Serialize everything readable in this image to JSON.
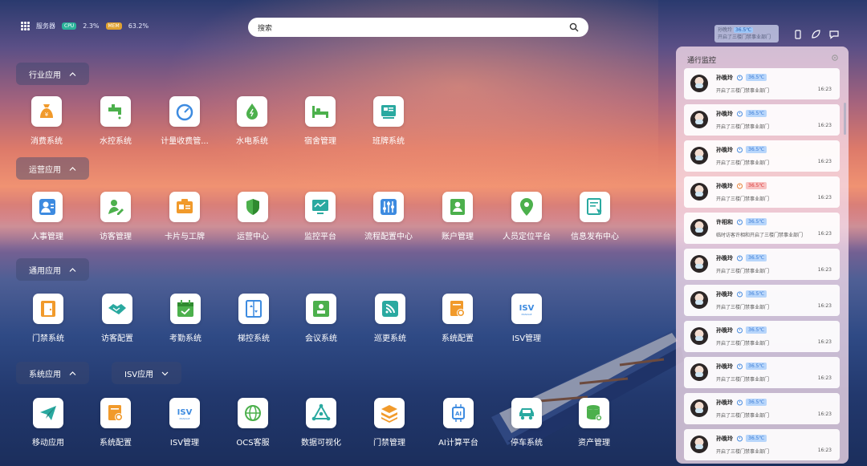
{
  "topbar": {
    "server_label": "服务器",
    "cpu_badge": "CPU",
    "cpu_value": "2.3%",
    "mem_badge": "MEM",
    "mem_value": "63.2%",
    "search_placeholder": "搜索",
    "user_chip": {
      "name": "孙晚玲",
      "temp": "36.5℃",
      "msg": "开启了三楼门禁事业部门"
    }
  },
  "sections": {
    "industry": {
      "label": "行业应用"
    },
    "operation": {
      "label": "运营应用"
    },
    "general": {
      "label": "通用应用"
    },
    "system": {
      "label": "系统应用"
    },
    "isv": {
      "label": "ISV应用"
    }
  },
  "apps": {
    "industry": [
      "消费系统",
      "水控系统",
      "计量收费管...",
      "水电系统",
      "宿舍管理",
      "班牌系统"
    ],
    "operation": [
      "人事管理",
      "访客管理",
      "卡片与工牌",
      "运营中心",
      "监控平台",
      "流程配置中心",
      "账户管理",
      "人员定位平台",
      "信息发布中心"
    ],
    "general": [
      "门禁系统",
      "访客配置",
      "考勤系统",
      "梯控系统",
      "会议系统",
      "巡更系统",
      "系统配置",
      "ISV管理"
    ],
    "system": [
      "移动应用",
      "系统配置",
      "ISV管理",
      "OCS客服",
      "数据可视化",
      "门禁管理",
      "AI计算平台",
      "停车系统",
      "资产管理"
    ]
  },
  "icons": {
    "industry": [
      "money-bag-icon",
      "faucet-icon",
      "meter-gauge-icon",
      "water-drop-icon",
      "bed-icon",
      "class-board-icon"
    ],
    "operation": [
      "person-icon",
      "visitor-icon",
      "id-card-icon",
      "shield-icon",
      "monitor-icon",
      "sliders-icon",
      "account-icon",
      "location-pin-icon",
      "publish-icon"
    ],
    "general": [
      "door-icon",
      "handshake-icon",
      "calendar-check-icon",
      "elevator-icon",
      "meeting-icon",
      "patrol-icon",
      "settings-doc-icon",
      "isv-icon"
    ],
    "system": [
      "paper-plane-icon",
      "settings-doc-icon",
      "isv-icon",
      "globe-icon",
      "data-graph-icon",
      "layers-icon",
      "ai-chip-icon",
      "car-icon",
      "database-icon"
    ]
  },
  "isv_logo": {
    "big": "ISV",
    "small": "MANAGE"
  },
  "colors": {
    "orange": "#f19a2b",
    "green": "#4cb04c",
    "blue": "#3d8be0",
    "teal": "#2aa9a0"
  },
  "panel": {
    "title": "通行监控",
    "cards": [
      {
        "name": "孙晚玲",
        "temp": "36.5℃",
        "hot": false,
        "msg": "开启了三楼门禁事业部门",
        "time": "16:23"
      },
      {
        "name": "孙晚玲",
        "temp": "36.5℃",
        "hot": false,
        "msg": "开启了三楼门禁事业部门",
        "time": "16:23"
      },
      {
        "name": "孙晚玲",
        "temp": "36.5℃",
        "hot": false,
        "msg": "开启了三楼门禁事业部门",
        "time": "16:23"
      },
      {
        "name": "孙晚玲",
        "temp": "36.5℃",
        "hot": true,
        "msg": "开启了三楼门禁事业部门",
        "time": "16:23"
      },
      {
        "name": "许相和",
        "temp": "36.5℃",
        "hot": false,
        "msg": "临时访客许相和开启了三楼门禁事业部门",
        "time": "16:23"
      },
      {
        "name": "孙晚玲",
        "temp": "36.5℃",
        "hot": false,
        "msg": "开启了三楼门禁事业部门",
        "time": "16:23"
      },
      {
        "name": "孙晚玲",
        "temp": "36.5℃",
        "hot": false,
        "msg": "开启了三楼门禁事业部门",
        "time": "16:23"
      },
      {
        "name": "孙晚玲",
        "temp": "36.5℃",
        "hot": false,
        "msg": "开启了三楼门禁事业部门",
        "time": "16:23"
      },
      {
        "name": "孙晚玲",
        "temp": "36.5℃",
        "hot": false,
        "msg": "开启了三楼门禁事业部门",
        "time": "16:23"
      },
      {
        "name": "孙晚玲",
        "temp": "36.5℃",
        "hot": false,
        "msg": "开启了三楼门禁事业部门",
        "time": "16:23"
      },
      {
        "name": "孙晚玲",
        "temp": "36.5℃",
        "hot": false,
        "msg": "开启了三楼门禁事业部门",
        "time": "16:23"
      }
    ]
  }
}
